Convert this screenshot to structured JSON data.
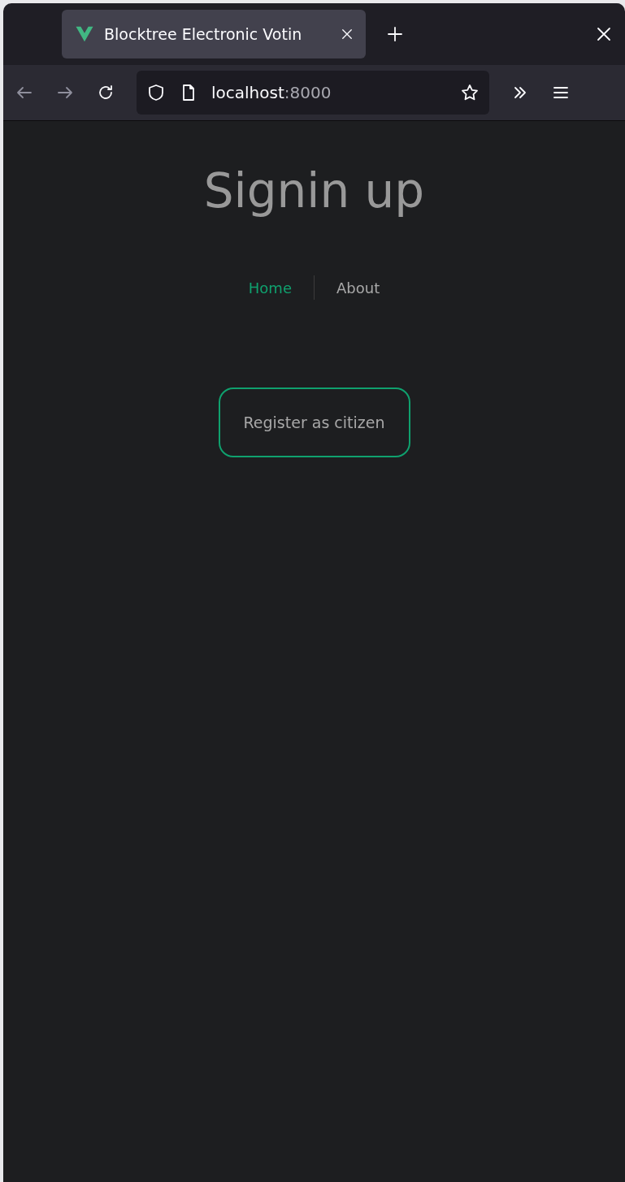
{
  "browser": {
    "tab": {
      "title": "Blocktree Electronic Votin",
      "selected": true
    },
    "url": {
      "host": "localhost",
      "port": ":8000"
    },
    "back_disabled": true,
    "forward_disabled": true
  },
  "page": {
    "title": "Signin up",
    "nav": [
      {
        "label": "Home",
        "selected": true
      },
      {
        "label": "About",
        "selected": false
      }
    ],
    "button": "Register as citizen"
  }
}
